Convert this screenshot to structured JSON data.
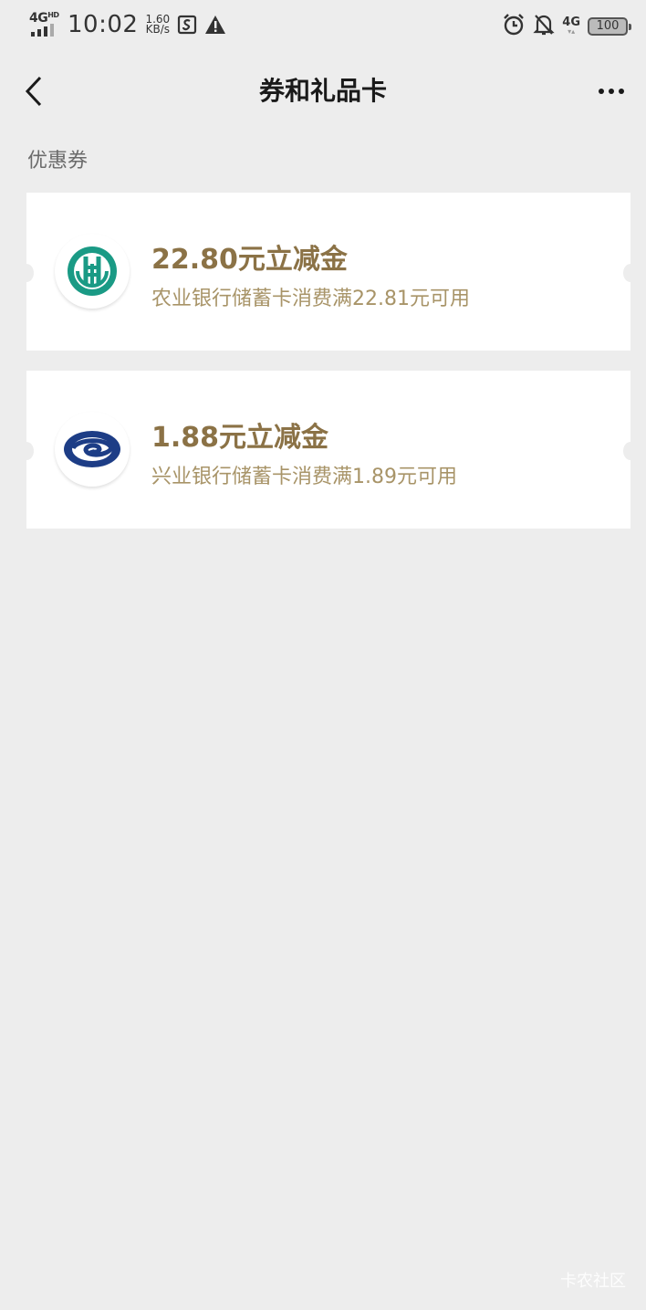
{
  "status_bar": {
    "network": "4G",
    "network_hd": "HD",
    "time": "10:02",
    "speed_value": "1.60",
    "speed_unit": "KB/s",
    "right_network": "4G",
    "battery": "100"
  },
  "nav": {
    "title": "券和礼品卡"
  },
  "section_label": "优惠券",
  "coupons": [
    {
      "title": "22.80元立减金",
      "desc": "农业银行储蓄卡消费满22.81元可用",
      "logo_color": "#1a9a85"
    },
    {
      "title": "1.88元立减金",
      "desc": "兴业银行储蓄卡消费满1.89元可用",
      "logo_color": "#1d3d86"
    }
  ],
  "watermark": "卡农社区",
  "colors": {
    "background": "#ededed",
    "coupon_title": "#8b7246",
    "coupon_desc": "#a89468"
  }
}
